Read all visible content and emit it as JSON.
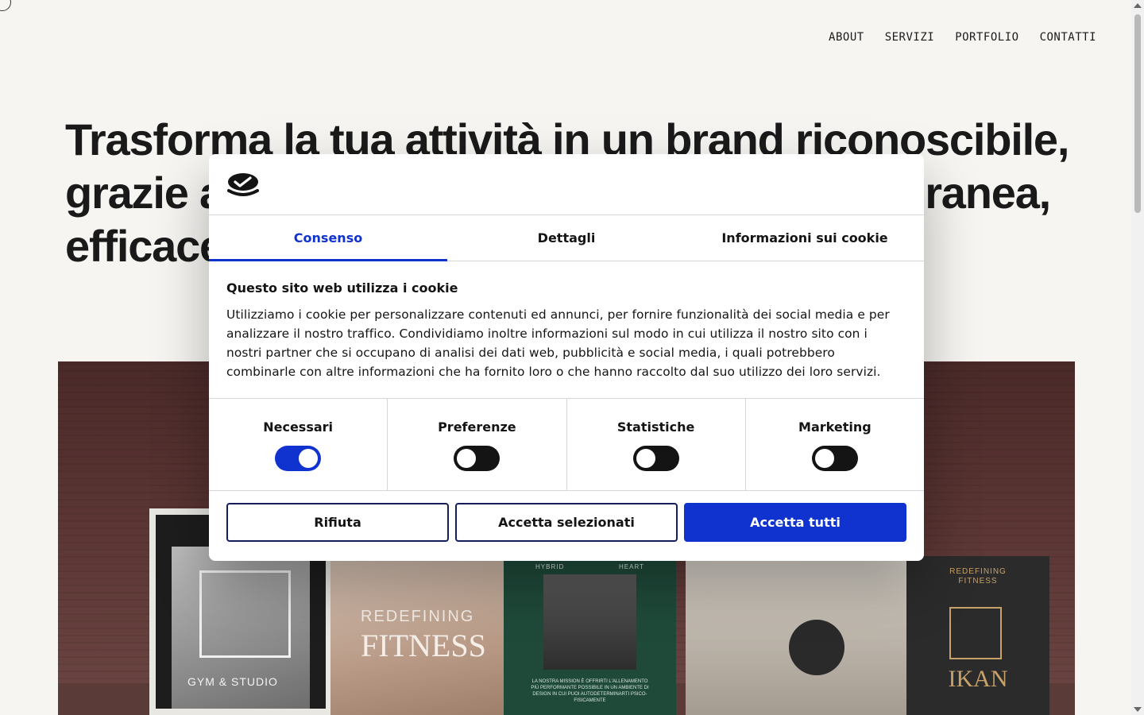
{
  "nav": {
    "items": [
      "ABOUT",
      "SERVIZI",
      "PORTFOLIO",
      "CONTATTI"
    ]
  },
  "hero": {
    "line1_pre": "Trasforma la tua attività in un ",
    "line1_bold": "brand riconoscibile",
    "line1_post": ",",
    "line2_left": "grazie a",
    "line2_right": "ranea,",
    "line3": "efficace"
  },
  "showcase": {
    "panel1_label": "GYM & STUDIO",
    "panel2_line1": "REDEFINING",
    "panel2_line2": "FITNESS",
    "panel3_top_left": "HYBRID",
    "panel3_top_right": "HEART",
    "panel3_caption": "LA NOSTRA MISSION È OFFRIRTI L'ALLENAMENTO PIÙ PERFORMANTE POSSIBILE IN UN AMBIENTE DI DESIGN IN CUI PUOI AUTODETERMINARTI PSICO-FISICAMENTE",
    "panel5_line1": "REDEFINING",
    "panel5_line2": "FITNESS",
    "panel5_brand": "IKAN"
  },
  "cookie": {
    "tabs": [
      "Consenso",
      "Dettagli",
      "Informazioni sui cookie"
    ],
    "active_tab": 0,
    "title": "Questo sito web utilizza i cookie",
    "text": "Utilizziamo i cookie per personalizzare contenuti ed annunci, per fornire funzionalità dei social media e per analizzare il nostro traffico. Condividiamo inoltre informazioni sul modo in cui utilizza il nostro sito con i nostri partner che si occupano di analisi dei dati web, pubblicità e social media, i quali potrebbero combinarle con altre informazioni che ha fornito loro o che hanno raccolto dal suo utilizzo dei loro servizi.",
    "toggles": [
      {
        "label": "Necessari",
        "on": true
      },
      {
        "label": "Preferenze",
        "on": false
      },
      {
        "label": "Statistiche",
        "on": false
      },
      {
        "label": "Marketing",
        "on": false
      }
    ],
    "buttons": {
      "reject": "Rifiuta",
      "accept_selected": "Accetta selezionati",
      "accept_all": "Accetta tutti"
    }
  },
  "colors": {
    "accent": "#1032cf",
    "page_bg": "#f6f5f2"
  }
}
